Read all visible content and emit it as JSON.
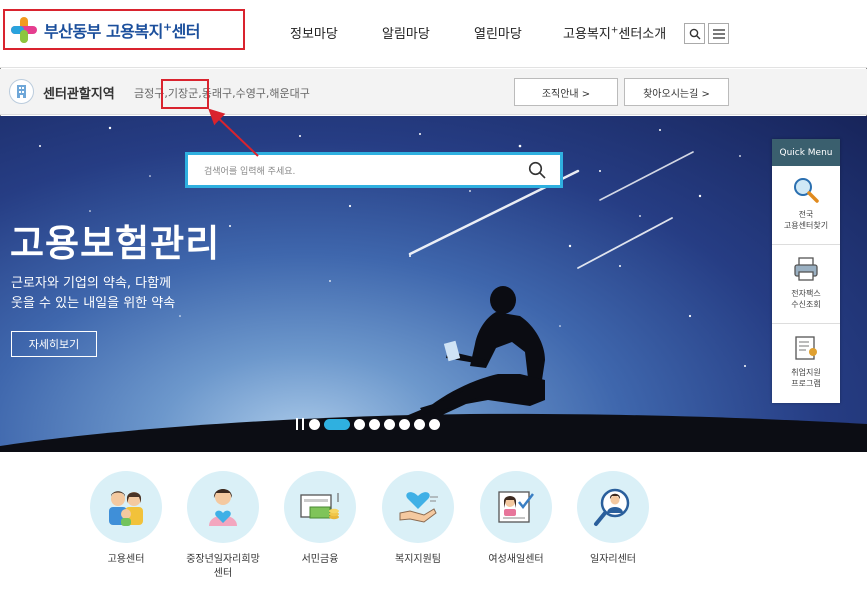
{
  "header": {
    "logo_text": "부산동부 고용복지",
    "logo_sup": "+",
    "logo_suffix": "센터",
    "nav": [
      {
        "label": "정보마당"
      },
      {
        "label": "알림마당"
      },
      {
        "label": "열린마당"
      },
      {
        "label": "고용복지",
        "sup": "+",
        "suffix": "센터소개"
      }
    ]
  },
  "subbar": {
    "title": "센터관할지역",
    "areas": "금정구,기장군,동래구,수영구,해운대구",
    "buttons": [
      "조직안내 >",
      "찾아오시는길 >"
    ]
  },
  "hero": {
    "search_placeholder": "검색어를 입력해 주세요.",
    "title": "고용보험관리",
    "subtitle_line1": "근로자와 기업의 약속, 다함께",
    "subtitle_line2": "웃을 수 있는 내일을 위한 약속",
    "cta": "자세히보기",
    "slide_count": 8,
    "active_slide": 1
  },
  "quick_menu": {
    "title": "Quick Menu",
    "items": [
      {
        "label": "전국\n고용센터찾기",
        "icon": "magnifier-icon"
      },
      {
        "label": "전자팩스\n수신조회",
        "icon": "fax-icon"
      },
      {
        "label": "취업지원\n프로그램",
        "icon": "certificate-icon"
      }
    ]
  },
  "services": [
    {
      "label": "고용센터",
      "icon": "family-icon"
    },
    {
      "label": "중장년일자리희망\n센터",
      "icon": "heart-person-icon"
    },
    {
      "label": "서민금융",
      "icon": "finance-icon"
    },
    {
      "label": "복지지원팀",
      "icon": "heart-hand-icon"
    },
    {
      "label": "여성새일센터",
      "icon": "woman-check-icon"
    },
    {
      "label": "일자리센터",
      "icon": "job-search-icon"
    }
  ],
  "colors": {
    "brand_blue": "#1b4f9c",
    "annotation_red": "#d9232e",
    "accent_cyan": "#2fb0e0",
    "quick_head": "#3a5f6e",
    "service_circle": "#daf0f7"
  }
}
